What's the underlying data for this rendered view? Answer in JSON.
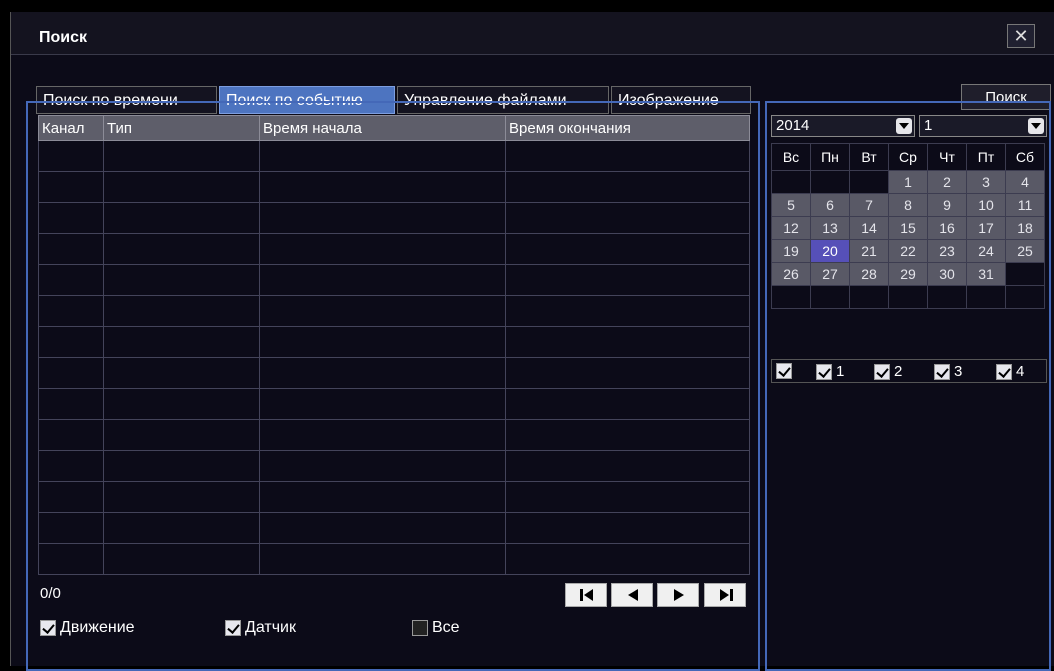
{
  "window": {
    "title": "Поиск"
  },
  "tabs": [
    {
      "label": "Поиск по времени",
      "active": false
    },
    {
      "label": "Поиск по событию",
      "active": true
    },
    {
      "label": "Управление файлами",
      "active": false
    },
    {
      "label": "Изображение",
      "active": false
    }
  ],
  "search_button": "Поиск",
  "table": {
    "columns": [
      "Канал",
      "Тип",
      "Время начала",
      "Время окончания"
    ],
    "rows": []
  },
  "pager": {
    "count": "0/0"
  },
  "filters": [
    {
      "label": "Движение",
      "checked": true
    },
    {
      "label": "Датчик",
      "checked": true
    },
    {
      "label": "Все",
      "checked": false
    }
  ],
  "calendar": {
    "year": "2014",
    "month": "1",
    "weekdays": [
      "Вс",
      "Пн",
      "Вт",
      "Ср",
      "Чт",
      "Пт",
      "Сб"
    ],
    "weeks": [
      [
        "",
        "",
        "",
        "1",
        "2",
        "3",
        "4"
      ],
      [
        "5",
        "6",
        "7",
        "8",
        "9",
        "10",
        "11"
      ],
      [
        "12",
        "13",
        "14",
        "15",
        "16",
        "17",
        "18"
      ],
      [
        "19",
        "20",
        "21",
        "22",
        "23",
        "24",
        "25"
      ],
      [
        "26",
        "27",
        "28",
        "29",
        "30",
        "31",
        ""
      ],
      [
        "",
        "",
        "",
        "",
        "",
        "",
        ""
      ]
    ],
    "selected_day": "20"
  },
  "channels": [
    {
      "label": "",
      "checked": true
    },
    {
      "label": "1",
      "checked": true
    },
    {
      "label": "2",
      "checked": true
    },
    {
      "label": "3",
      "checked": true
    },
    {
      "label": "4",
      "checked": true
    }
  ],
  "icons": [
    "close-icon",
    "first-page-icon",
    "prev-page-icon",
    "next-page-icon",
    "last-page-icon",
    "dropdown-arrow-icon",
    "checkbox-icon"
  ]
}
